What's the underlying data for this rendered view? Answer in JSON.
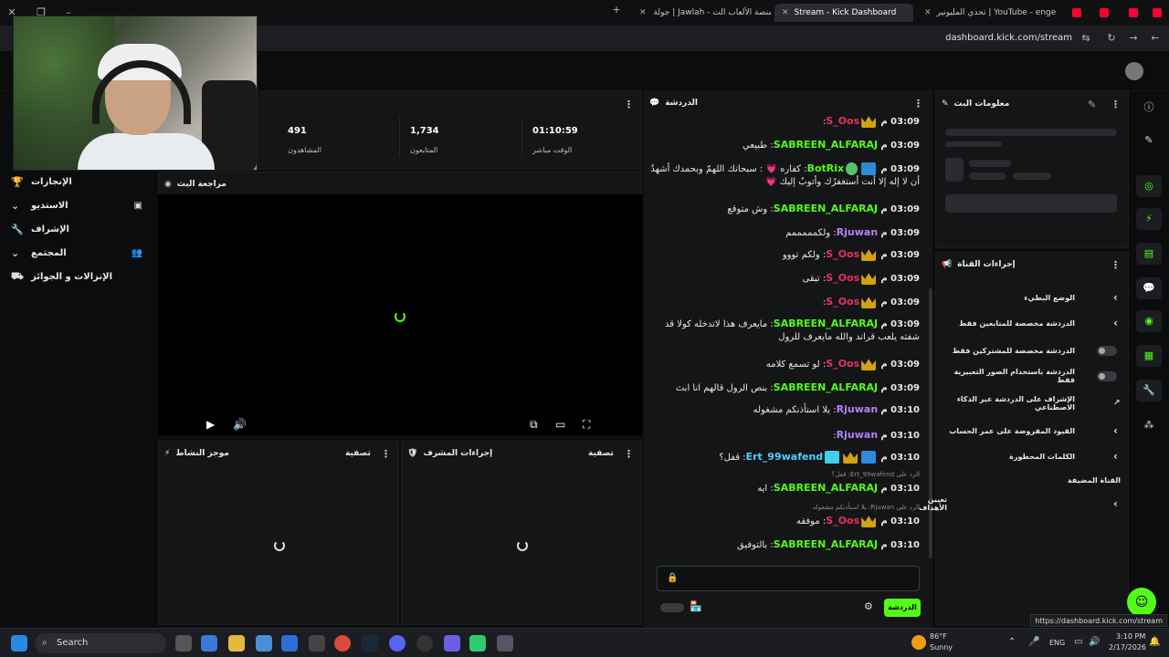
{
  "browser": {
    "tabs": [
      {
        "title": "جولة | Jawlah - منصة الألعاب الت...",
        "favicon_color": "#5b5bd6",
        "active": false
      },
      {
        "title": "Stream - Kick Dashboard",
        "favicon_color": "#53fc18",
        "active": true
      },
      {
        "title": "تحدي المليونير | YouTube - enge",
        "favicon_color": "#ff0033",
        "active": false
      }
    ],
    "url": "dashboard.kick.com/stream"
  },
  "sidebar": {
    "items": [
      {
        "label": "الإنجازات",
        "icon": "trophy-icon"
      },
      {
        "label": "الاستديو",
        "icon": "studio-icon"
      },
      {
        "label": "الإشراف",
        "icon": "wrench-icon"
      },
      {
        "label": "المجتمع",
        "icon": "users-icon"
      },
      {
        "label": "الإنزالات و الجوائز",
        "icon": "drops-icon"
      }
    ]
  },
  "stats": {
    "viewers_value": "491",
    "viewers_label": "المشاهدون",
    "followers_value": "1,734",
    "followers_label": "المتابعون",
    "live_value": "01:10:59",
    "live_label": "الوقت مباشر"
  },
  "stream_preview": {
    "title": "مراجعة البث"
  },
  "activity_feed": {
    "title": "موجز النشاط",
    "filter": "تصفية"
  },
  "mod_actions": {
    "title": "إجراءات المشرف",
    "filter": "تصفية"
  },
  "chat": {
    "title": "الدردشة",
    "send_label": "الدردشة",
    "messages": [
      {
        "time": "03:09 م",
        "user": "S_Oos",
        "color": "#e8315f",
        "text": "",
        "badges": [
          "crown"
        ]
      },
      {
        "time": "03:09 م",
        "user": "SABREEN_ALFARAJ",
        "color": "#53fc18",
        "text": "طبيعي",
        "badges": []
      },
      {
        "time": "03:09 م",
        "user": "BotRix",
        "color": "#53fc18",
        "text": "كفاره 💗 : سبحانك اللهمّ وبحمدك أشهدُ أن لا إله إلا أنت أستغفرُك وأتوبُ إليك 💗",
        "badges": [
          "blue",
          "verified"
        ]
      },
      {
        "time": "03:09 م",
        "user": "SABREEN_ALFARAJ",
        "color": "#53fc18",
        "text": "وش متوقع",
        "badges": []
      },
      {
        "time": "03:09 م",
        "user": "Rjuwan",
        "color": "#b084f5",
        "text": "ولكمممممم",
        "badges": []
      },
      {
        "time": "03:09 م",
        "user": "S_Oos",
        "color": "#e8315f",
        "text": "ولكم تووو",
        "badges": [
          "crown"
        ]
      },
      {
        "time": "03:09 م",
        "user": "S_Oos",
        "color": "#e8315f",
        "text": "تبقى",
        "badges": [
          "crown"
        ]
      },
      {
        "time": "03:09 م",
        "user": "S_Oos",
        "color": "#e8315f",
        "text": "",
        "badges": [
          "crown"
        ]
      },
      {
        "time": "03:09 م",
        "user": "SABREEN_ALFARAJ",
        "color": "#53fc18",
        "text": "مايعرف هذا لاتدخله كولا قد شفته يلعب قراند والله مايعرف للرول",
        "badges": []
      },
      {
        "time": "03:09 م",
        "user": "S_Oos",
        "color": "#e8315f",
        "text": "لو تسمع كلامه",
        "badges": [
          "crown"
        ]
      },
      {
        "time": "03:09 م",
        "user": "SABREEN_ALFARAJ",
        "color": "#53fc18",
        "text": "بنص الرول قالهم انا ابث",
        "badges": []
      },
      {
        "time": "03:10 م",
        "user": "Rjuwan",
        "color": "#b084f5",
        "text": "يلا استأذنكم مشغوله",
        "badges": []
      },
      {
        "time": "03:10 م",
        "user": "Rjuwan",
        "color": "#b084f5",
        "text": "",
        "badges": []
      },
      {
        "time": "03:10 م",
        "user": "Ert_99wafend",
        "color": "#4fd1ff",
        "text": "قفل؟",
        "badges": [
          "blue",
          "crown",
          "og"
        ]
      },
      {
        "time": "03:10 م",
        "user": "SABREEN_ALFARAJ",
        "color": "#53fc18",
        "text": "ايه",
        "badges": [],
        "reply": "الرد على Ert_99wafend: قفل؟"
      },
      {
        "time": "03:10 م",
        "user": "S_Oos",
        "color": "#e8315f",
        "text": "موفقه",
        "badges": [
          "crown"
        ],
        "reply": "الرد على Rjuwan: يلا استأذنكم مشغوله"
      },
      {
        "time": "03:10 م",
        "user": "SABREEN_ALFARAJ",
        "color": "#53fc18",
        "text": "بالتوفيق",
        "badges": []
      }
    ]
  },
  "stream_info": {
    "title": "معلومات البث"
  },
  "channel_actions": {
    "title": "إجراءات القناة",
    "rows": [
      {
        "label": "الوضع البطيء",
        "control": "chevron"
      },
      {
        "label": "الدردشة مخصصة للمتابعين فقط",
        "control": "chevron"
      },
      {
        "label": "الدردشة مخصصة للمشتركين فقط",
        "control": "toggle"
      },
      {
        "label": "الدردشة باستخدام الصور التعبيرية فقط",
        "control": "toggle"
      },
      {
        "label": "الإشراف على الدردشة عبر الذكاء الاصطناعي",
        "control": "external"
      },
      {
        "label": "القيود المفروضة على عمر الحساب",
        "control": "chevron"
      },
      {
        "label": "الكلمات المحظورة",
        "control": "chevron"
      }
    ],
    "section": "القناة المضيفة",
    "host_row": "تعيين الأهداف"
  },
  "status_url": "https://dashboard.kick.com/stream",
  "taskbar": {
    "search": "Search",
    "weather_temp": "86°F",
    "weather_desc": "Sunny",
    "lang": "ENG",
    "time": "3:10 PM",
    "date": "2/17/2026"
  }
}
